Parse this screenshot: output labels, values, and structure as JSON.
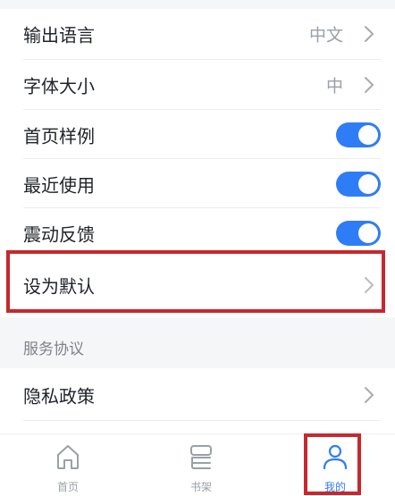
{
  "settings": {
    "output_language": {
      "label": "输出语言",
      "value": "中文"
    },
    "font_size": {
      "label": "字体大小",
      "value": "中"
    },
    "homepage_sample": {
      "label": "首页样例",
      "enabled": true
    },
    "recently_used": {
      "label": "最近使用",
      "enabled": true
    },
    "vibration_feedback": {
      "label": "震动反馈",
      "enabled": true
    },
    "set_default": {
      "label": "设为默认"
    }
  },
  "service": {
    "header": "服务协议",
    "privacy_policy": {
      "label": "隐私政策"
    }
  },
  "tabbar": {
    "home": "首页",
    "bookshelf": "书架",
    "mine": "我的",
    "active": "mine"
  },
  "colors": {
    "accent": "#2f7df6",
    "highlight_box": "#c8272e"
  }
}
